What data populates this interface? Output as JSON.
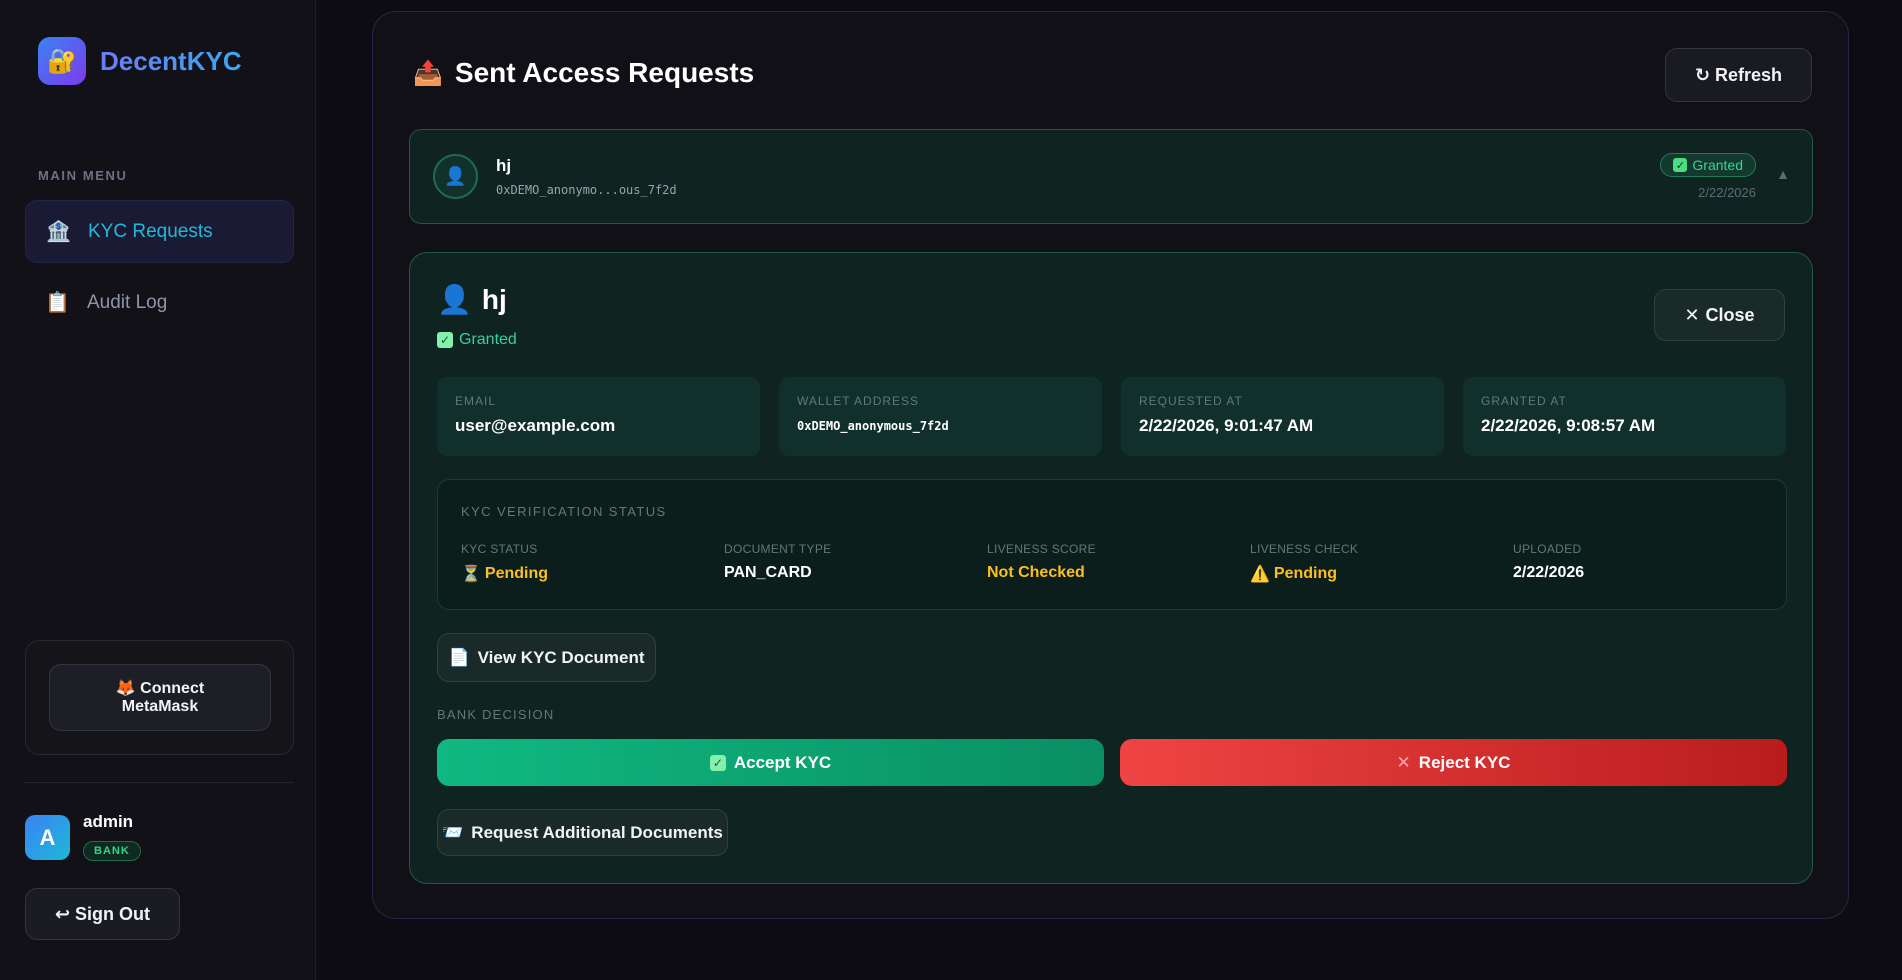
{
  "brand": {
    "name": "DecentKYC",
    "logo_icon": "🔐"
  },
  "sidebar": {
    "menu_heading": "MAIN MENU",
    "items": [
      {
        "label": "KYC Requests",
        "icon": "🏦",
        "active": true
      },
      {
        "label": "Audit Log",
        "icon": "📋",
        "active": false
      }
    ],
    "connect_button": {
      "line1": "🦊 Connect",
      "line2": "MetaMask"
    },
    "user": {
      "initial": "A",
      "name": "admin",
      "role": "BANK"
    },
    "sign_out_label": "↩ Sign Out"
  },
  "main": {
    "title": "Sent Access Requests",
    "title_icon": "📤",
    "refresh_label": "↻ Refresh",
    "request": {
      "avatar_icon": "👤",
      "name": "hj",
      "address": "0xDEMO_anonymo...ous_7f2d",
      "status": "Granted",
      "date": "2/22/2026",
      "expand_icon": "▲"
    },
    "detail": {
      "avatar_icon": "👤",
      "name": "hj",
      "status": "Granted",
      "close_label": "Close",
      "info": [
        {
          "label": "EMAIL",
          "value": "user@example.com",
          "mono": false
        },
        {
          "label": "WALLET ADDRESS",
          "value": "0xDEMO_anonymous_7f2d",
          "mono": true
        },
        {
          "label": "REQUESTED AT",
          "value": "2/22/2026, 9:01:47 AM",
          "mono": false
        },
        {
          "label": "GRANTED AT",
          "value": "2/22/2026, 9:08:57 AM",
          "mono": false
        }
      ],
      "kyc": {
        "heading": "KYC VERIFICATION STATUS",
        "fields": [
          {
            "label": "KYC STATUS",
            "value": "Pending",
            "icon": "⏳",
            "warn": true
          },
          {
            "label": "DOCUMENT TYPE",
            "value": "PAN_CARD",
            "icon": "",
            "warn": false
          },
          {
            "label": "LIVENESS SCORE",
            "value": "Not Checked",
            "icon": "",
            "warn": true
          },
          {
            "label": "LIVENESS CHECK",
            "value": "Pending",
            "icon": "⚠️",
            "warn": true
          },
          {
            "label": "UPLOADED",
            "value": "2/22/2026",
            "icon": "",
            "warn": false
          }
        ]
      },
      "view_doc_label": "View KYC Document",
      "view_doc_icon": "📄",
      "bank_decision_label": "BANK DECISION",
      "accept_label": "Accept KYC",
      "reject_label": "Reject KYC",
      "request_docs_label": "Request Additional Documents",
      "request_docs_icon": "📨"
    }
  },
  "colors": {
    "accent": "#22b8d8",
    "success": "#34d399",
    "warning": "#fbbf24",
    "danger": "#ef4444"
  }
}
